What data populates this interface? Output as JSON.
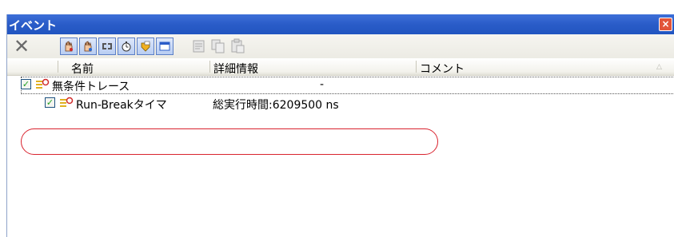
{
  "window": {
    "title": "イベント",
    "close_icon": "close-icon"
  },
  "toolbar": {
    "delete_icon": "delete-x-icon",
    "buttons": [
      {
        "icon": "hardware-break-icon"
      },
      {
        "icon": "software-break-icon"
      },
      {
        "icon": "trace-icon"
      },
      {
        "icon": "timer-icon"
      },
      {
        "icon": "condition-icon"
      },
      {
        "icon": "view-icon"
      }
    ],
    "disabled_buttons": [
      {
        "icon": "edit-icon"
      },
      {
        "icon": "copy-icon"
      },
      {
        "icon": "paste-icon"
      }
    ]
  },
  "table": {
    "columns": [
      "名前",
      "詳細情報",
      "コメント"
    ],
    "sort_indicator": "△",
    "rows": [
      {
        "checked": true,
        "icon": "event-icon",
        "name": "無条件トレース",
        "detail": "-",
        "comment": ""
      },
      {
        "checked": true,
        "icon": "event-icon",
        "name": "Run-Breakタイマ",
        "detail": "総実行時間:6209500 ns",
        "comment": ""
      }
    ]
  },
  "colors": {
    "titlebar": "#2a5cc8",
    "highlight": "#d9232e",
    "check": "#21a121"
  }
}
